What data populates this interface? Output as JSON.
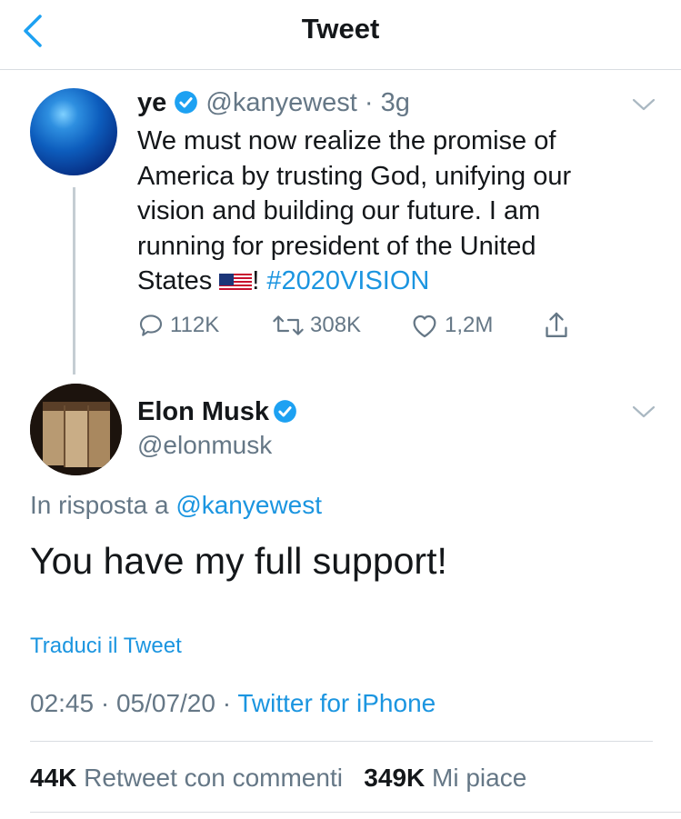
{
  "header": {
    "title": "Tweet"
  },
  "parent_tweet": {
    "name": "ye",
    "handle": "@kanyewest",
    "separator": " · ",
    "time": "3g",
    "text_before_flag": "We must now realize the promise of America by trusting God, unifying our vision and building our future. I am running for president of the United States ",
    "flag_emoji": "🇺🇸",
    "text_after_flag": "! ",
    "hashtag": "#2020VISION",
    "replies": "112K",
    "retweets": "308K",
    "likes": "1,2M"
  },
  "main_tweet": {
    "name": "Elon Musk",
    "handle": "@elonmusk",
    "reply_prefix": "In risposta a ",
    "reply_to": "@kanyewest",
    "text": "You have my full support!",
    "translate": "Traduci il Tweet",
    "timestamp": "02:45 · 05/07/20",
    "meta_separator": " · ",
    "source": "Twitter for iPhone",
    "retweets_with_comments_count": "44K",
    "retweets_with_comments_label": "Retweet con commenti",
    "likes_count": "349K",
    "likes_label": "Mi piace"
  },
  "colors": {
    "link": "#1b95e0",
    "secondary": "#657786",
    "verified": "#1da1f2"
  },
  "icons": [
    "back-chevron-icon",
    "verified-badge-icon",
    "chevron-down-icon",
    "reply-icon",
    "retweet-icon",
    "like-icon",
    "share-icon",
    "us-flag-icon"
  ]
}
